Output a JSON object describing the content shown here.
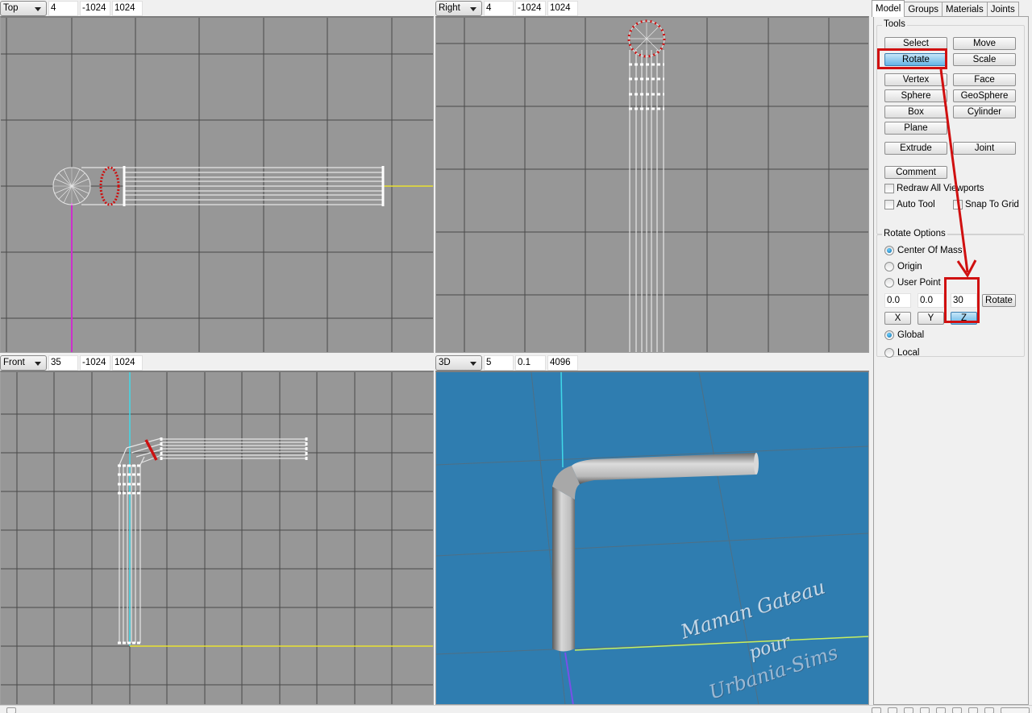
{
  "viewports": [
    {
      "id": "top",
      "view": "Top",
      "grid": "4",
      "min": "-1024",
      "max": "1024"
    },
    {
      "id": "right",
      "view": "Right",
      "grid": "4",
      "min": "-1024",
      "max": "1024"
    },
    {
      "id": "front",
      "view": "Front",
      "grid": "35",
      "min": "-1024",
      "max": "1024"
    },
    {
      "id": "3d",
      "view": "3D",
      "grid": "5",
      "min": "0.1",
      "max": "4096"
    }
  ],
  "panel": {
    "tabs": [
      {
        "label": "Model",
        "active": true
      },
      {
        "label": "Groups",
        "active": false
      },
      {
        "label": "Materials",
        "active": false
      },
      {
        "label": "Joints",
        "active": false
      }
    ],
    "tools": {
      "title": "Tools",
      "buttons": {
        "select": "Select",
        "move": "Move",
        "rotate": "Rotate",
        "scale": "Scale",
        "vertex": "Vertex",
        "face": "Face",
        "sphere": "Sphere",
        "geosphere": "GeoSphere",
        "box": "Box",
        "cylinder": "Cylinder",
        "plane": "Plane",
        "extrude": "Extrude",
        "joint": "Joint",
        "comment": "Comment"
      },
      "active_tool": "Rotate",
      "checkboxes": {
        "redraw_all": {
          "label": "Redraw All Viewports",
          "checked": false
        },
        "auto_tool": {
          "label": "Auto Tool",
          "checked": false
        },
        "snap_to_grid": {
          "label": "Snap To Grid",
          "checked": false
        }
      }
    },
    "rotate_options": {
      "title": "Rotate Options",
      "pivot": {
        "center_of_mass": {
          "label": "Center Of Mass",
          "selected": true
        },
        "origin": {
          "label": "Origin",
          "selected": false
        },
        "user_point": {
          "label": "User Point",
          "selected": false
        }
      },
      "values": {
        "x": "0.0",
        "y": "0.0",
        "z": "30"
      },
      "rotate_button": "Rotate",
      "axis_buttons": {
        "x": "X",
        "y": "Y",
        "z": "Z"
      },
      "active_axis": "Z",
      "space": {
        "global": {
          "label": "Global",
          "selected": true
        },
        "local": {
          "label": "Local",
          "selected": false
        }
      }
    }
  },
  "watermark": {
    "line1": "Maman Gateau",
    "line2": "pour",
    "line3": "Urbania-Sims"
  },
  "colors": {
    "viewport_bg": "#979797",
    "grid_line": "#4a4a4a",
    "view3d_bg": "#2f7db0",
    "wire": "#e6e6e6",
    "selected_vertex": "#cc1111",
    "axis_x": "#e8e030",
    "axis_y": "#40d8e8",
    "axis_z": "#cc30cc",
    "annotation": "#d01010",
    "pressed_button": "#64b4e6"
  }
}
